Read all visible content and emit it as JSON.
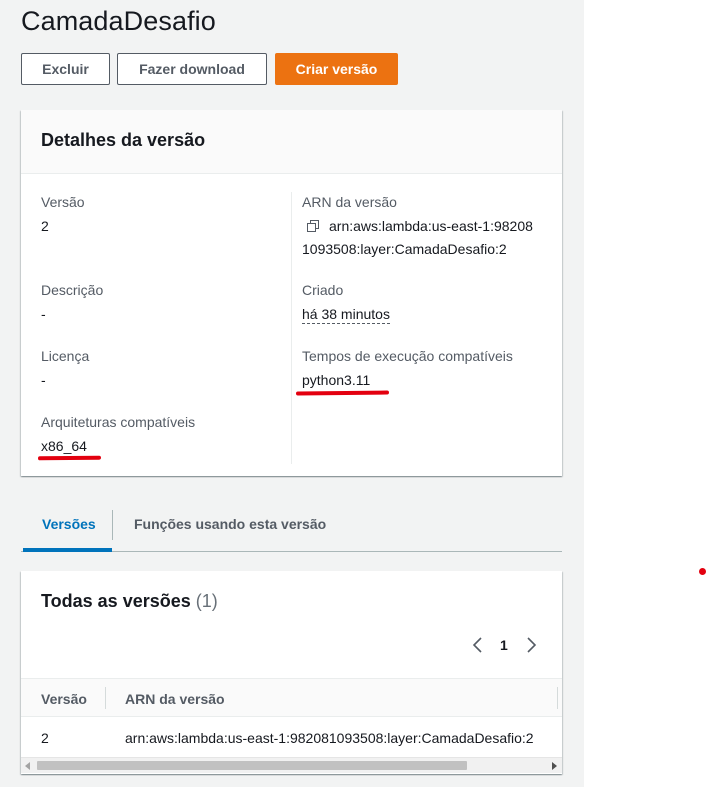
{
  "page": {
    "title": "CamadaDesafio"
  },
  "toolbar": {
    "delete_label": "Excluir",
    "download_label": "Fazer download",
    "create_version_label": "Criar versão"
  },
  "details": {
    "title": "Detalhes da versão",
    "version_label": "Versão",
    "version_value": "2",
    "description_label": "Descrição",
    "description_value": "-",
    "license_label": "Licença",
    "license_value": "-",
    "architectures_label": "Arquiteturas compatíveis",
    "architectures_value": "x86_64",
    "arn_label": "ARN da versão",
    "arn_line1": "arn:aws:lambda:us-east-1:98208",
    "arn_line2": "1093508:layer:CamadaDesafio:2",
    "created_label": "Criado",
    "created_value": "há 38 minutos",
    "runtimes_label": "Tempos de execução compatíveis",
    "runtimes_value": "python3.11"
  },
  "tabs": [
    {
      "label": "Versões",
      "active": true
    },
    {
      "label": "Funções usando esta versão",
      "active": false
    }
  ],
  "versions_table": {
    "title": "Todas as versões",
    "count": "(1)",
    "pagination": {
      "current_page": "1"
    },
    "columns": [
      "Versão",
      "ARN da versão"
    ],
    "rows": [
      {
        "version": "2",
        "arn": "arn:aws:lambda:us-east-1:982081093508:layer:CamadaDesafio:2"
      }
    ]
  },
  "colors": {
    "primary": "#ec7211",
    "active_tab": "#0073bb",
    "annotation_red": "#e3000f"
  }
}
